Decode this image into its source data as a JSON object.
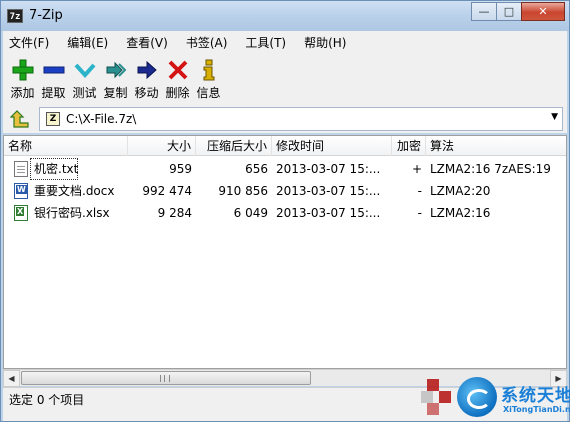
{
  "window": {
    "title": "7-Zip",
    "app_icon_text": "7z"
  },
  "window_controls": {
    "minimize": "—",
    "maximize": "□",
    "close": "✕"
  },
  "menu": [
    "文件(F)",
    "编辑(E)",
    "查看(V)",
    "书签(A)",
    "工具(T)",
    "帮助(H)"
  ],
  "toolbar": [
    {
      "label": "添加",
      "icon": "plus-icon",
      "color": "#1aa51a"
    },
    {
      "label": "提取",
      "icon": "minus-icon",
      "color": "#1a3fc4"
    },
    {
      "label": "测试",
      "icon": "check-icon",
      "color": "#2ab3c9"
    },
    {
      "label": "复制",
      "icon": "double-arrow-icon",
      "color": "#2b8f8f"
    },
    {
      "label": "移动",
      "icon": "arrow-right-icon",
      "color": "#1a2a8f"
    },
    {
      "label": "删除",
      "icon": "x-icon",
      "color": "#d41414"
    },
    {
      "label": "信息",
      "icon": "info-icon",
      "color": "#d9b000"
    }
  ],
  "address": {
    "path": "C:\\X-File.7z\\",
    "icon_text": "Z"
  },
  "columns": [
    "名称",
    "大小",
    "压缩后大小",
    "修改时间",
    "加密",
    "算法"
  ],
  "files": [
    {
      "name": "机密.txt",
      "size": "959",
      "packed": "656",
      "modified": "2013-03-07 15:...",
      "encrypted": "+",
      "method": "LZMA2:16 7zAES:19",
      "type": "txt"
    },
    {
      "name": "重要文档.docx",
      "size": "992 474",
      "packed": "910 856",
      "modified": "2013-03-07 15:...",
      "encrypted": "-",
      "method": "LZMA2:20",
      "type": "doc"
    },
    {
      "name": "银行密码.xlsx",
      "size": "9 284",
      "packed": "6 049",
      "modified": "2013-03-07 15:...",
      "encrypted": "-",
      "method": "LZMA2:16",
      "type": "xls"
    }
  ],
  "status": {
    "text": "选定 0 个项目"
  },
  "watermark": {
    "title": "系统天地",
    "url": "XiTongTianDi.net"
  }
}
